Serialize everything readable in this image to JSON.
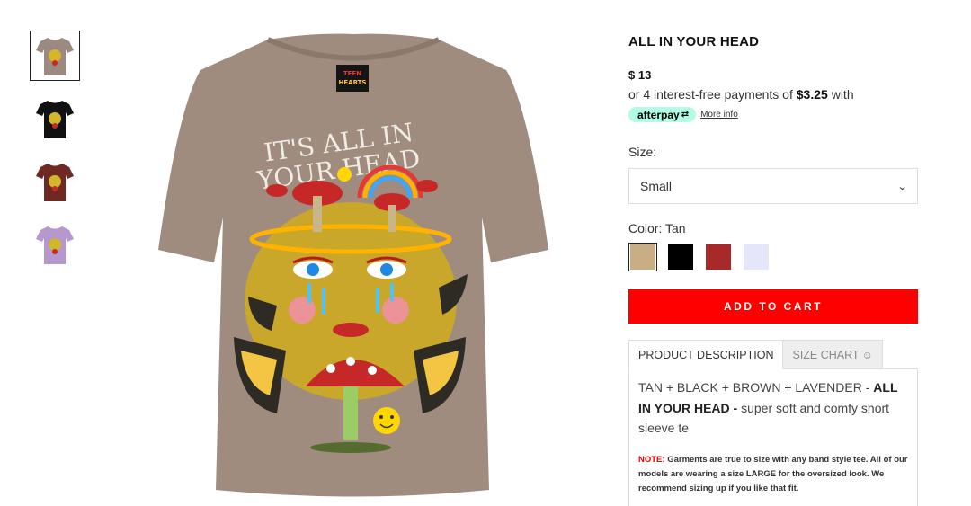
{
  "product": {
    "title": "ALL IN YOUR HEAD",
    "price": "$ 13",
    "afterpay_prefix": "or 4 interest-free payments of ",
    "afterpay_amount": "$3.25",
    "afterpay_suffix": " with",
    "afterpay_brand": "afterpay",
    "more_info": "More info"
  },
  "size": {
    "label": "Size:",
    "selected": "Small"
  },
  "color": {
    "label": "Color: Tan",
    "swatches": [
      {
        "name": "Tan",
        "hex": "#c9ad85",
        "selected": true
      },
      {
        "name": "Black",
        "hex": "#000000",
        "selected": false
      },
      {
        "name": "Brown",
        "hex": "#a8292a",
        "selected": false
      },
      {
        "name": "Lavender",
        "hex": "#e6e6fb",
        "selected": false
      }
    ]
  },
  "cart": {
    "button_label": "ADD TO CART"
  },
  "tabs": [
    {
      "label": "PRODUCT DESCRIPTION",
      "active": true
    },
    {
      "label": "SIZE CHART",
      "active": false,
      "icon": "smiley-icon"
    }
  ],
  "description": {
    "text_part1": "TAN + BLACK + BROWN + LAVENDER - ",
    "text_bold": "ALL IN YOUR HEAD -",
    "text_part2": " super soft and comfy short sleeve te",
    "note_label": "NOTE:",
    "note_text": " Garments are true to size with any band style tee. All of our models are wearing a size LARGE for the oversized look. We recommend sizing up if you like that fit."
  },
  "image": {
    "tag_text": "TEEN HEARTS",
    "print_text_line1": "IT'S ALL IN",
    "print_text_line2": "YOUR HEAD"
  },
  "thumbnails": [
    {
      "color": "#9c8a80",
      "active": true
    },
    {
      "color": "#111111",
      "active": false
    },
    {
      "color": "#6e2a22",
      "active": false
    },
    {
      "color": "#b498cf",
      "active": false
    }
  ],
  "colors": {
    "accent": "#ff0000",
    "afterpay": "#b2fce4",
    "shirt": "#9f8c7f"
  }
}
